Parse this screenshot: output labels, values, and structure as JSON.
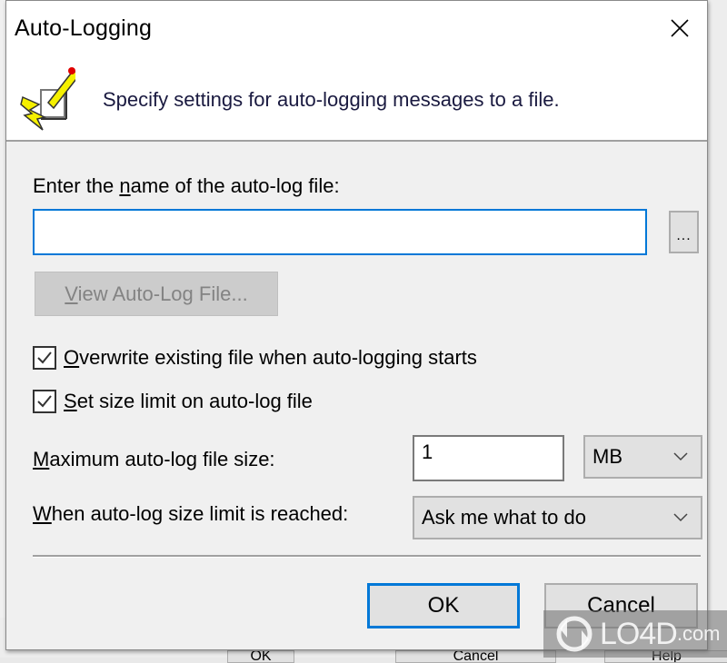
{
  "dialog": {
    "title": "Auto-Logging",
    "close_label": "Close",
    "description": "Specify settings for auto-logging messages to a file."
  },
  "file_section": {
    "label_before": "Enter the ",
    "label_accel": "n",
    "label_after": "ame of the auto-log file:",
    "file_name_value": "",
    "file_name_placeholder": "",
    "browse_label": "...",
    "view_button_accel": "V",
    "view_button_rest": "iew Auto-Log File...",
    "view_button_enabled": false
  },
  "options": {
    "overwrite": {
      "accel": "O",
      "rest": "verwrite existing file when auto-logging starts",
      "checked": true
    },
    "size_limit": {
      "accel": "S",
      "rest": "et size limit on auto-log file",
      "checked": true
    }
  },
  "limits": {
    "max_size_accel": "M",
    "max_size_rest": "aximum auto-log file size:",
    "max_size_value": "1",
    "unit_selected": "MB",
    "on_limit_accel": "W",
    "on_limit_rest": "hen auto-log size limit is reached:",
    "on_limit_selected": "Ask me what to do"
  },
  "buttons": {
    "ok": "OK",
    "cancel": "Cancel"
  },
  "background_window": {
    "buttons": [
      "OK",
      "Cancel",
      "Help"
    ]
  },
  "watermark": {
    "text": "LO4D",
    "suffix": ".com"
  },
  "colors": {
    "accent": "#0078d7",
    "dialog_bg": "#f0f0f0",
    "header_bg": "#ffffff",
    "disabled_text": "#838383"
  }
}
